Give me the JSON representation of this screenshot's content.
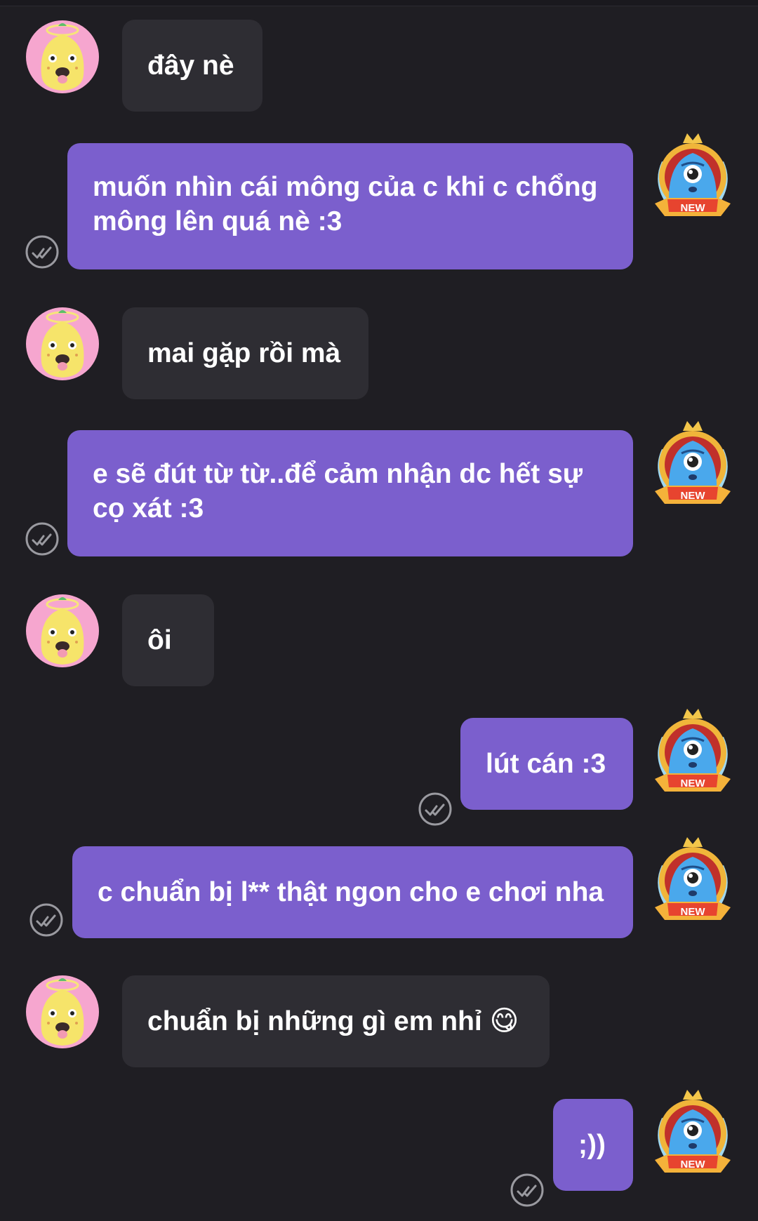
{
  "conversation": {
    "messages": [
      {
        "side": "incoming",
        "text": "đây nè"
      },
      {
        "side": "outgoing",
        "text": "muốn nhìn cái mông của c khi c chổng mông lên quá nè :3",
        "read": true
      },
      {
        "side": "incoming",
        "text": "mai gặp rồi mà"
      },
      {
        "side": "outgoing",
        "text": "e sẽ đút từ từ..để cảm nhận dc hết sự cọ xát :3",
        "read": true
      },
      {
        "side": "incoming",
        "text": "ôi"
      },
      {
        "side": "outgoing",
        "text": "lút cán :3",
        "read": true
      },
      {
        "side": "outgoing",
        "text": "c chuẩn bị l** thật ngon cho e chơi nha",
        "read": true
      },
      {
        "side": "incoming",
        "text": "chuẩn bị những gì em nhỉ",
        "emoji": "😋"
      },
      {
        "side": "outgoing",
        "text": ";))",
        "read": true
      }
    ]
  },
  "badge": {
    "label": "NEW"
  },
  "colors": {
    "background": "#1f1e23",
    "incoming_bubble": "#2e2d33",
    "outgoing_bubble": "#7b5fcd",
    "read_check": "#9a9aa0"
  },
  "icons": {
    "incoming_avatar": "yellow-blob-angel-avatar-icon",
    "outgoing_avatar": "blue-monster-new-badge-avatar-icon",
    "read_receipt": "double-check-icon"
  }
}
